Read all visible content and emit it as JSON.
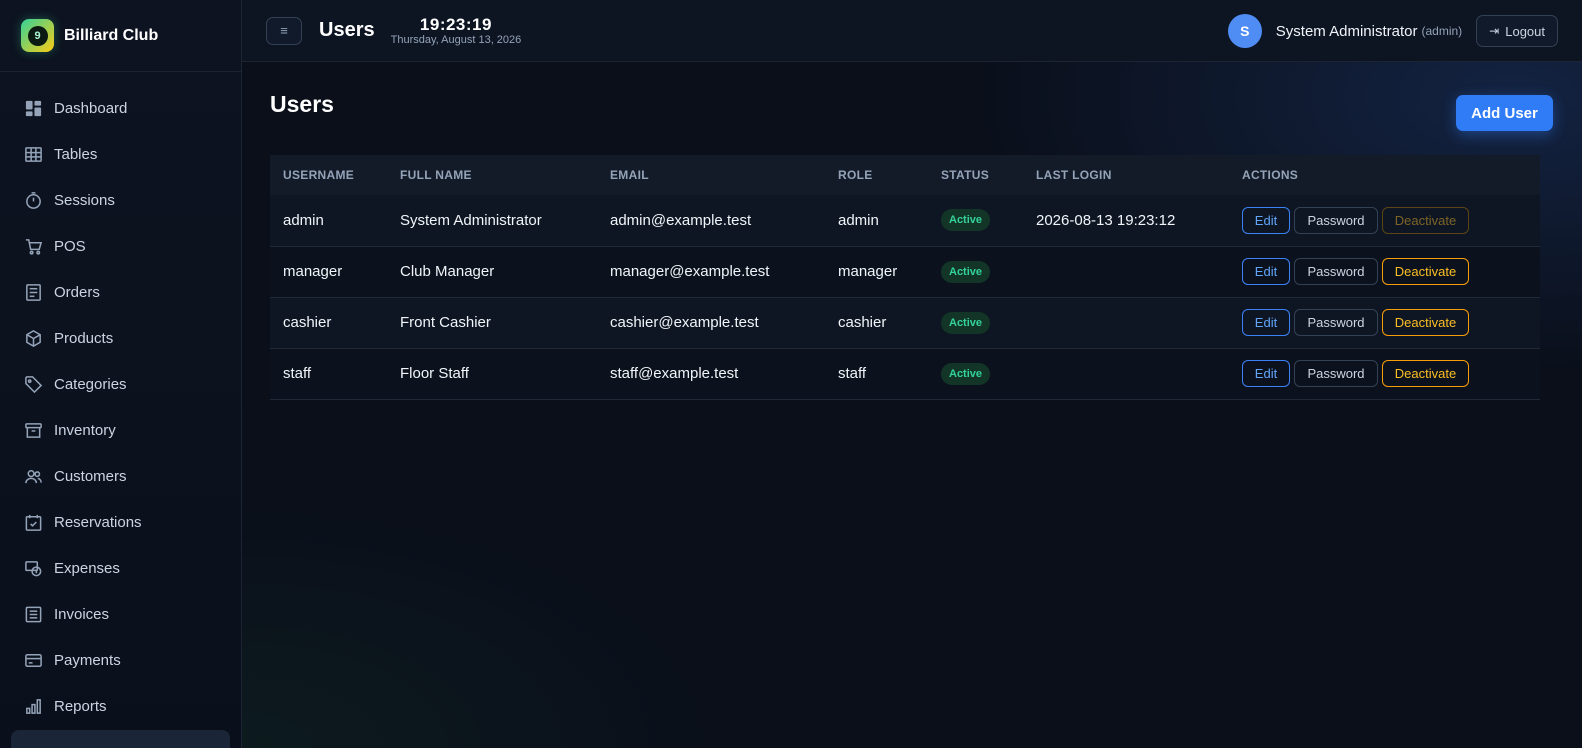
{
  "app": {
    "name": "Billiard Club",
    "logo_text": "9"
  },
  "sidebar": {
    "items": [
      {
        "label": "Dashboard",
        "icon": "dashboard-icon"
      },
      {
        "label": "Tables",
        "icon": "table-icon"
      },
      {
        "label": "Sessions",
        "icon": "timer-icon"
      },
      {
        "label": "POS",
        "icon": "cart-icon"
      },
      {
        "label": "Orders",
        "icon": "receipt-icon"
      },
      {
        "label": "Products",
        "icon": "box-icon"
      },
      {
        "label": "Categories",
        "icon": "tag-icon"
      },
      {
        "label": "Inventory",
        "icon": "archive-icon"
      },
      {
        "label": "Customers",
        "icon": "users-icon"
      },
      {
        "label": "Reservations",
        "icon": "calendar-check-icon"
      },
      {
        "label": "Expenses",
        "icon": "money-icon"
      },
      {
        "label": "Invoices",
        "icon": "invoice-icon"
      },
      {
        "label": "Payments",
        "icon": "card-icon"
      },
      {
        "label": "Reports",
        "icon": "bar-chart-icon"
      }
    ]
  },
  "header": {
    "menu_icon": "≡",
    "title": "Users",
    "time": "19:23:19",
    "date": "Thursday, August 13, 2026",
    "avatar_letter": "S",
    "user_name": "System Administrator",
    "user_role": "(admin)",
    "logout_label": "Logout"
  },
  "main": {
    "title": "Users",
    "add_button": "Add User",
    "columns": [
      "USERNAME",
      "FULL NAME",
      "EMAIL",
      "ROLE",
      "STATUS",
      "LAST LOGIN",
      "ACTIONS"
    ],
    "rows": [
      {
        "username": "admin",
        "full_name": "System Administrator",
        "email": "admin@example.test",
        "role": "admin",
        "status": "Active",
        "last_login": "2026-08-13 19:23:12",
        "deactivate_disabled": true
      },
      {
        "username": "manager",
        "full_name": "Club Manager",
        "email": "manager@example.test",
        "role": "manager",
        "status": "Active",
        "last_login": "",
        "deactivate_disabled": false
      },
      {
        "username": "cashier",
        "full_name": "Front Cashier",
        "email": "cashier@example.test",
        "role": "cashier",
        "status": "Active",
        "last_login": "",
        "deactivate_disabled": false
      },
      {
        "username": "staff",
        "full_name": "Floor Staff",
        "email": "staff@example.test",
        "role": "staff",
        "status": "Active",
        "last_login": "",
        "deactivate_disabled": false
      }
    ],
    "actions": {
      "edit": "Edit",
      "password": "Password",
      "deactivate": "Deactivate"
    }
  },
  "colors": {
    "accent": "#2f7cf6",
    "status_active": "#34d399",
    "warning": "#fbbf24",
    "background": "#0a0f1a"
  }
}
